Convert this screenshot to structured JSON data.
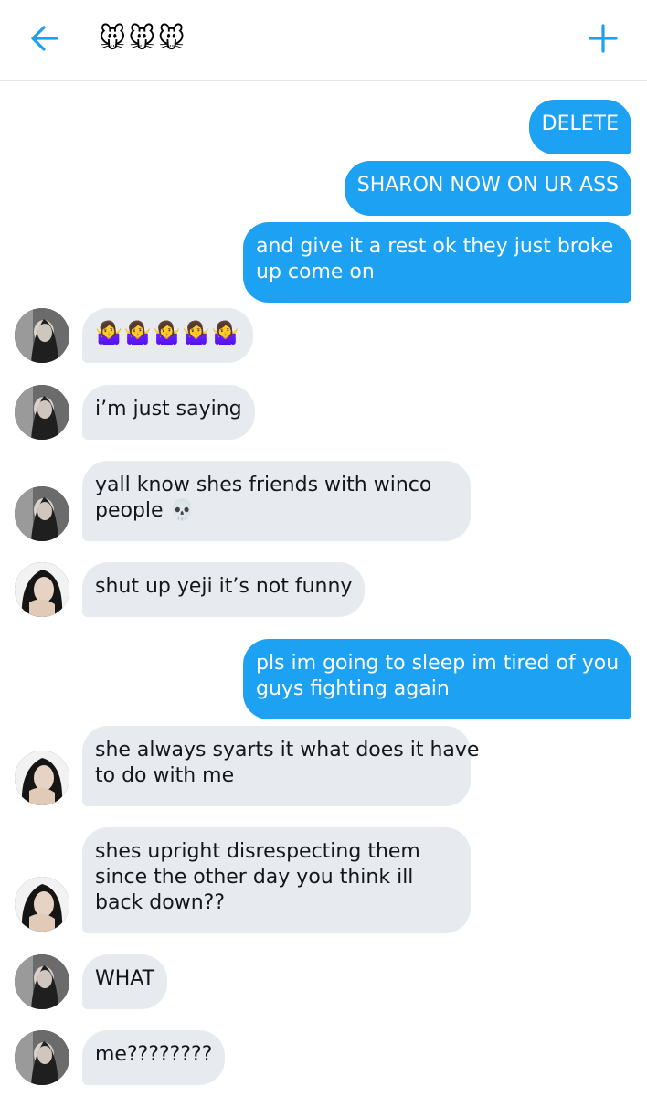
{
  "header": {
    "title": "🐭🐭🐭",
    "back_icon": "arrow-left-icon",
    "add_icon": "plus-icon",
    "accent": "#1da1f2"
  },
  "messages": [
    {
      "side": "out",
      "text": "DELETE"
    },
    {
      "side": "out",
      "text": "SHARON NOW ON UR ASS"
    },
    {
      "side": "out",
      "lines": [
        "and give it a rest ok they just broke",
        "up come on"
      ]
    },
    {
      "side": "in",
      "avatar": "avatar-a",
      "text": "🤷‍♀️🤷‍♀️🤷‍♀️🤷‍♀️🤷‍♀️"
    },
    {
      "side": "in",
      "avatar": "avatar-a",
      "text": "i’m just saying"
    },
    {
      "side": "in",
      "avatar": "avatar-a",
      "lines": [
        "yall know shes friends with winco",
        "people 💀"
      ]
    },
    {
      "side": "in",
      "avatar": "avatar-b",
      "text": "shut up yeji it’s not funny"
    },
    {
      "side": "out",
      "lines": [
        "pls im going to sleep im tired of you",
        "guys fighting again"
      ]
    },
    {
      "side": "in",
      "avatar": "avatar-b",
      "lines": [
        "she always syarts it what does it have",
        "to do with me"
      ]
    },
    {
      "side": "in",
      "avatar": "avatar-b",
      "lines": [
        "shes upright disrespecting them",
        "since the other day you think ill",
        "back down??"
      ]
    },
    {
      "side": "in",
      "avatar": "avatar-a",
      "text": "WHAT"
    },
    {
      "side": "in",
      "avatar": "avatar-a",
      "text": "me????????"
    }
  ]
}
